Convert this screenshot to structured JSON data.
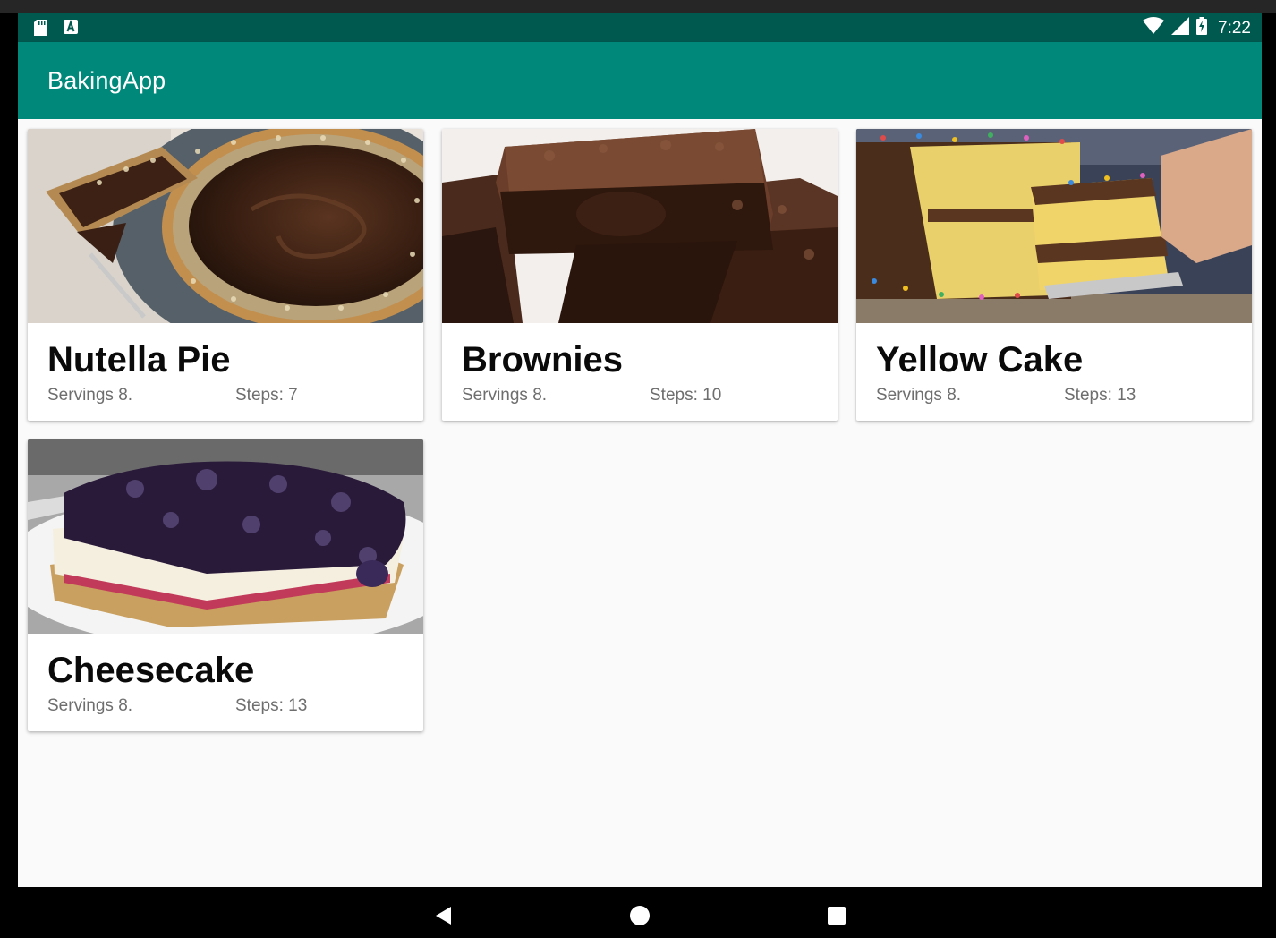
{
  "status_bar": {
    "time": "7:22",
    "icons": [
      "sd-card-icon",
      "a-notification-icon",
      "wifi-icon",
      "cell-signal-icon",
      "battery-charging-icon"
    ]
  },
  "app_bar": {
    "title": "BakingApp",
    "color": "#00887a",
    "status_color": "#00594f"
  },
  "recipes": [
    {
      "name": "Nutella Pie",
      "servings": "Servings 8.",
      "steps": "Steps: 7"
    },
    {
      "name": "Brownies",
      "servings": "Servings 8.",
      "steps": "Steps: 10"
    },
    {
      "name": "Yellow Cake",
      "servings": "Servings 8.",
      "steps": "Steps: 13"
    },
    {
      "name": "Cheesecake",
      "servings": "Servings 8.",
      "steps": "Steps: 13"
    }
  ],
  "nav_bar": {
    "icons": [
      "back-icon",
      "home-icon",
      "recents-icon"
    ]
  }
}
